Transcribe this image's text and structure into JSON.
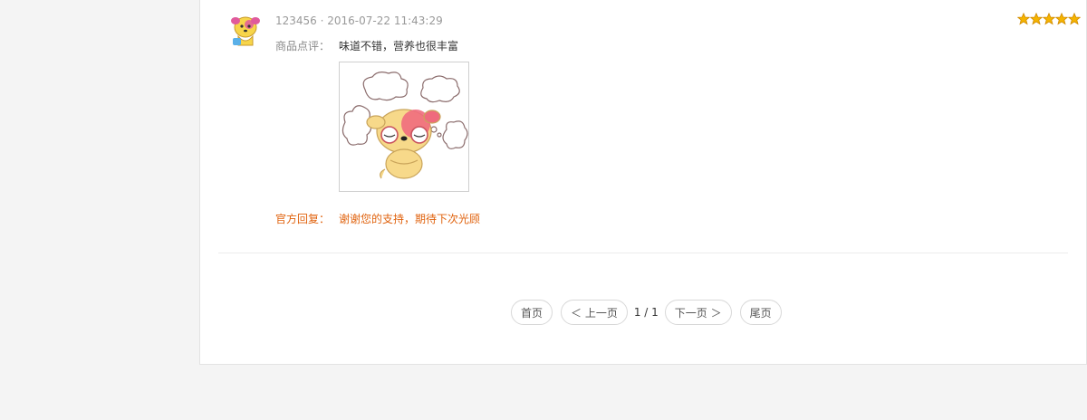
{
  "review": {
    "user": "123456",
    "date": "2016-07-22 11:43:29",
    "meta_separator": " · ",
    "rating": 5,
    "star_color": "#f5b400",
    "comment_label": "商品点评：",
    "comment_text": "味道不错，营养也很丰富",
    "reply_label": "官方回复：",
    "reply_text": "谢谢您的支持，期待下次光顾",
    "reply_color": "#e0620d"
  },
  "pagination": {
    "first": "首页",
    "prev": "＜ 上一页",
    "info": "1 / 1",
    "next": "下一页 ＞",
    "last": "尾页"
  }
}
